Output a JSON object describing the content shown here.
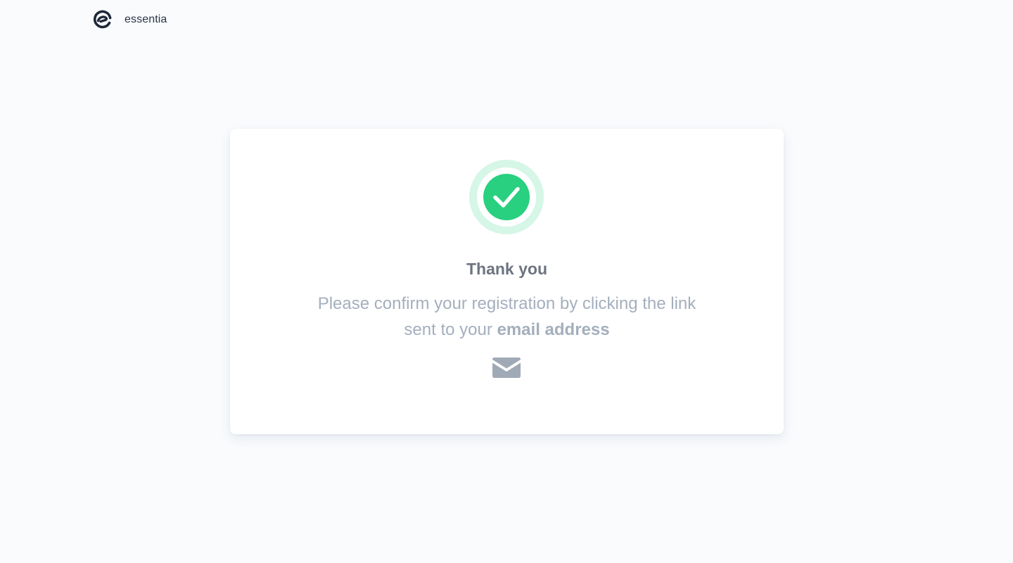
{
  "brand": {
    "name": "essentia",
    "logo_icon": "essentia-logo-icon"
  },
  "card": {
    "status_icon": "check-circle-icon",
    "title": "Thank you",
    "message_part1": "Please confirm your registration by clicking the link sent to your ",
    "message_emphasis": "email address",
    "mail_icon": "envelope-icon"
  },
  "colors": {
    "background": "#f9fbfd",
    "success_green": "#28d07f",
    "success_ring": "#d6f6e7",
    "title_text": "#6d7480",
    "muted_text": "#a4afbd",
    "icon_gray": "#a0aab7",
    "brand_dark": "#2b3447"
  }
}
